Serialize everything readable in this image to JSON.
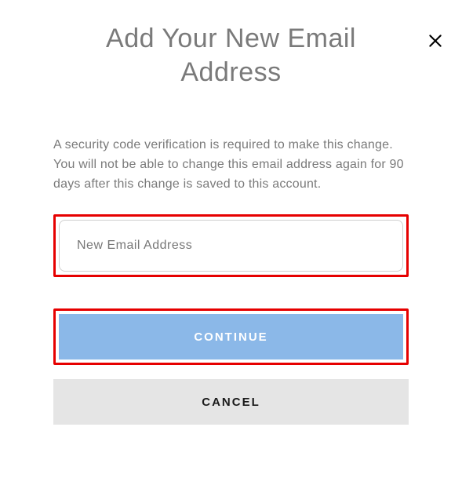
{
  "modal": {
    "title": "Add Your New Email Address",
    "description": "A security code verification is required to make this change. You will not be able to change this email address again for 90 days after this change is saved to this account.",
    "email_placeholder": "New Email Address",
    "continue_label": "CONTINUE",
    "cancel_label": "CANCEL"
  }
}
